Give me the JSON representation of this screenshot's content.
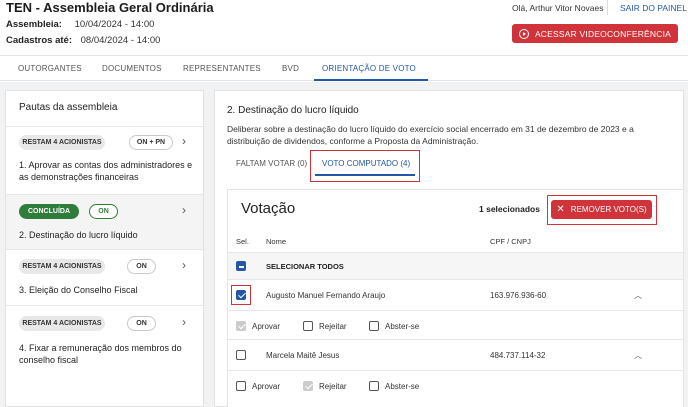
{
  "header": {
    "title": "TEN - Assembleia Geral Ordinária",
    "assembleia_label": "Assembleia:",
    "assembleia_value": "10/04/2024 - 14:00",
    "cadastros_label": "Cadastros até:",
    "cadastros_value": "08/04/2024 - 14:00",
    "greeting": "Olá, Arthur Vitor Novaes",
    "logout": "SAIR DO PAINEL",
    "video_button": "ACESSAR VIDEOCONFERÊNCIA"
  },
  "tabs": [
    {
      "label": "OUTORGANTES"
    },
    {
      "label": "DOCUMENTOS"
    },
    {
      "label": "REPRESENTANTES"
    },
    {
      "label": "BVD"
    },
    {
      "label": "ORIENTAÇÃO DE VOTO"
    }
  ],
  "sidebar": {
    "title": "Pautas da assembleia",
    "items": [
      {
        "status": "RESTAM 4 ACIONISTAS",
        "type": "ON + PN",
        "title": "1. Aprovar as contas dos administradores e as demonstrações financeiras"
      },
      {
        "status": "CONCLUÍDA",
        "type": "ON",
        "title": "2. Destinação do lucro líquido"
      },
      {
        "status": "RESTAM 4 ACIONISTAS",
        "type": "ON",
        "title": "3. Eleição do Conselho Fiscal"
      },
      {
        "status": "RESTAM 4 ACIONISTAS",
        "type": "ON",
        "title": "4. Fixar a remuneração dos membros do conselho fiscal"
      }
    ]
  },
  "detail": {
    "title": "2. Destinação do lucro líquido",
    "description": "Deliberar sobre a destinação do lucro líquido do exercício social encerrado em 31 de dezembro de 2023 e a distribuição de dividendos, conforme a Proposta da Administração.",
    "subtab_pending": "FALTAM VOTAR (0)",
    "subtab_computed": "VOTO COMPUTADO (4)"
  },
  "voting": {
    "title": "Votação",
    "selected_count": "1 selecionados",
    "remove_button": "REMOVER VOTO(S)",
    "col_sel": "Sel.",
    "col_name": "Nome",
    "col_doc": "CPF / CNPJ",
    "select_all": "SELECIONAR TODOS",
    "rows": [
      {
        "name": "Augusto Manuel Fernando Araujo",
        "doc": "163.976.936-60",
        "opt1": "Aprovar",
        "opt2": "Rejeitar",
        "opt3": "Abster-se"
      },
      {
        "name": "Marcela Maitê Jesus",
        "doc": "484.737.114-32",
        "opt1": "Aprovar",
        "opt2": "Rejeitar",
        "opt3": "Abster-se"
      }
    ]
  }
}
